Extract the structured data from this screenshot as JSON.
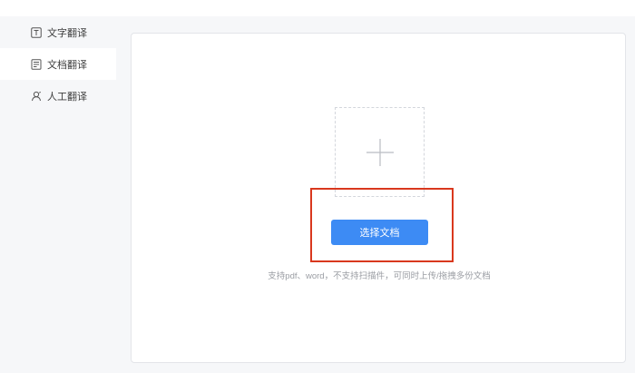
{
  "sidebar": {
    "items": [
      {
        "label": "文字翻译",
        "icon": "text-box-icon",
        "active": false
      },
      {
        "label": "文档翻译",
        "icon": "document-icon",
        "active": true
      },
      {
        "label": "人工翻译",
        "icon": "human-translation-icon",
        "active": false
      }
    ]
  },
  "upload": {
    "button_label": "选择文档",
    "hint": "支持pdf、word，不支持扫描件，可同时上传/拖拽多份文档",
    "plus_icon": "plus-icon"
  },
  "colors": {
    "accent": "#3d8bf4",
    "highlight_border": "#d9381e",
    "sidebar_bg": "#f6f7f9",
    "hint_text": "#9a9da3"
  }
}
